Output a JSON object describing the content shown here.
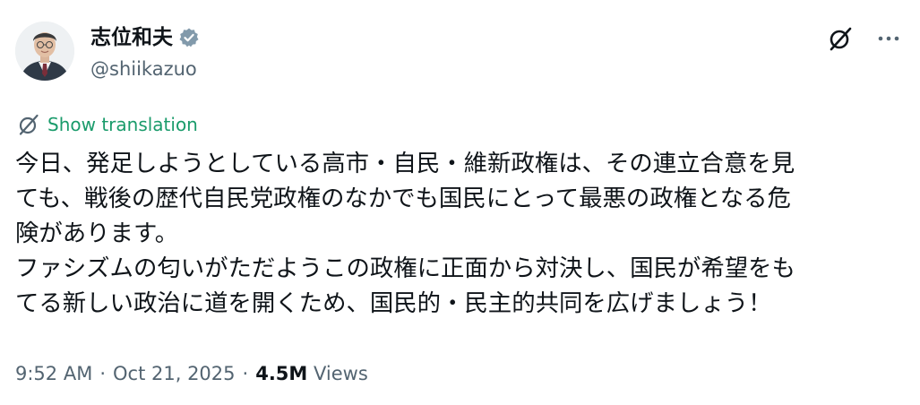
{
  "author": {
    "display_name": "志位和夫",
    "handle": "@shiikazuo",
    "verified": true,
    "verified_color": "#829aab"
  },
  "actions": {
    "grok_icon": "grok-icon",
    "more_icon": "more-icon"
  },
  "translate": {
    "label": "Show translation",
    "color": "#1a9b6b"
  },
  "tweet": {
    "lines": [
      "今日、発足しようとしている高市・自民・維新政権は、その連立合意を見",
      "ても、戦後の歴代自民党政権のなかでも国民にとって最悪の政権となる危",
      "険があります。",
      "ファシズムの匂いがただようこの政権に正面から対決し、国民が希望をも",
      "てる新しい政治に道を開くため、国民的・民主的共同を広げましょう！"
    ]
  },
  "meta": {
    "time": "9:52 AM",
    "separator": "·",
    "date": "Oct 21, 2025",
    "views_count": "4.5M",
    "views_label": "Views"
  }
}
